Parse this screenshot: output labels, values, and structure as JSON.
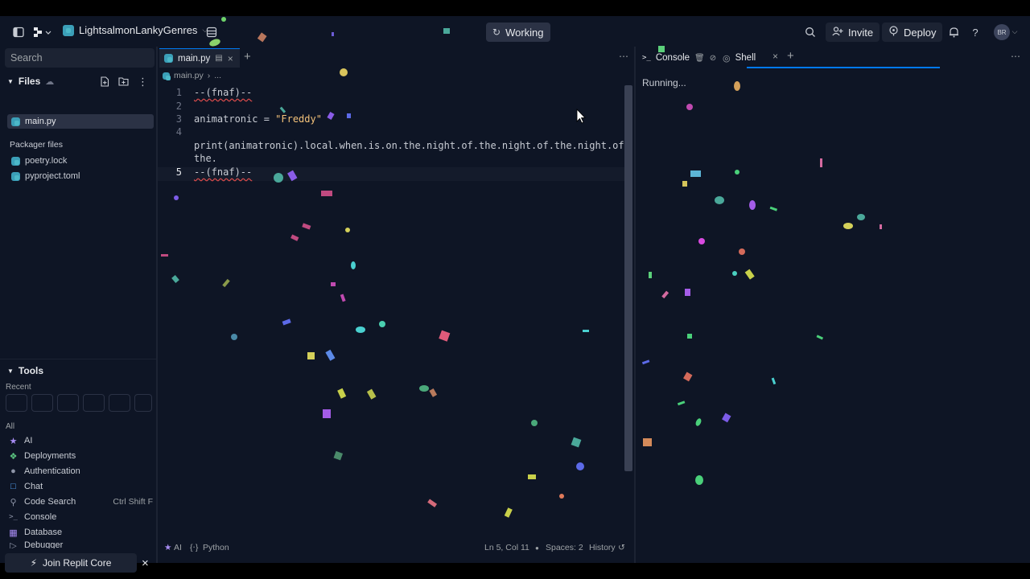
{
  "header": {
    "repl_name": "LightsalmonLankyGenres",
    "status": "Working",
    "invite_label": "Invite",
    "deploy_label": "Deploy",
    "avatar_initials": "BR",
    "accent_color": "#0079f2"
  },
  "sidebar": {
    "search_placeholder": "Search",
    "files_title": "Files",
    "files": [
      {
        "name": "main.py",
        "active": true
      }
    ],
    "packager_title": "Packager files",
    "packager_files": [
      "poetry.lock",
      "pyproject.toml"
    ],
    "tools_title": "Tools",
    "recent_label": "Recent",
    "all_label": "All",
    "tools": [
      {
        "label": "AI",
        "icon": "ai-icon",
        "shortcut": ""
      },
      {
        "label": "Deployments",
        "icon": "deployments-icon",
        "shortcut": ""
      },
      {
        "label": "Authentication",
        "icon": "user-icon",
        "shortcut": ""
      },
      {
        "label": "Chat",
        "icon": "chat-icon",
        "shortcut": ""
      },
      {
        "label": "Code Search",
        "icon": "search-icon",
        "shortcut": "Ctrl Shift F"
      },
      {
        "label": "Console",
        "icon": "terminal-icon",
        "shortcut": ""
      },
      {
        "label": "Database",
        "icon": "database-icon",
        "shortcut": ""
      },
      {
        "label": "Debugger",
        "icon": "debugger-icon",
        "shortcut": ""
      }
    ],
    "core_button": "Join Replit Core"
  },
  "editor": {
    "tab_label": "main.py",
    "breadcrumb_file": "main.py",
    "breadcrumb_more": "...",
    "lines": [
      {
        "num": "1",
        "text": "--(fnaf)--"
      },
      {
        "num": "2",
        "text": ""
      },
      {
        "num": "3",
        "text_pre": "animatronic = ",
        "text_str": "\"Freddy\""
      },
      {
        "num": "4",
        "text": ""
      },
      {
        "num": "",
        "text": "print(animatronic).local.when.is.on.the.night.of.the.night.of.the.night.of."
      },
      {
        "num": "",
        "text": "the."
      },
      {
        "num": "5",
        "text": "--(fnaf)--"
      }
    ],
    "status": {
      "ai": "AI",
      "language": "Python",
      "position": "Ln 5, Col 11",
      "spaces": "Spaces: 2",
      "history": "History"
    }
  },
  "console": {
    "tab_console": "Console",
    "tab_shell": "Shell",
    "output": "Running..."
  }
}
